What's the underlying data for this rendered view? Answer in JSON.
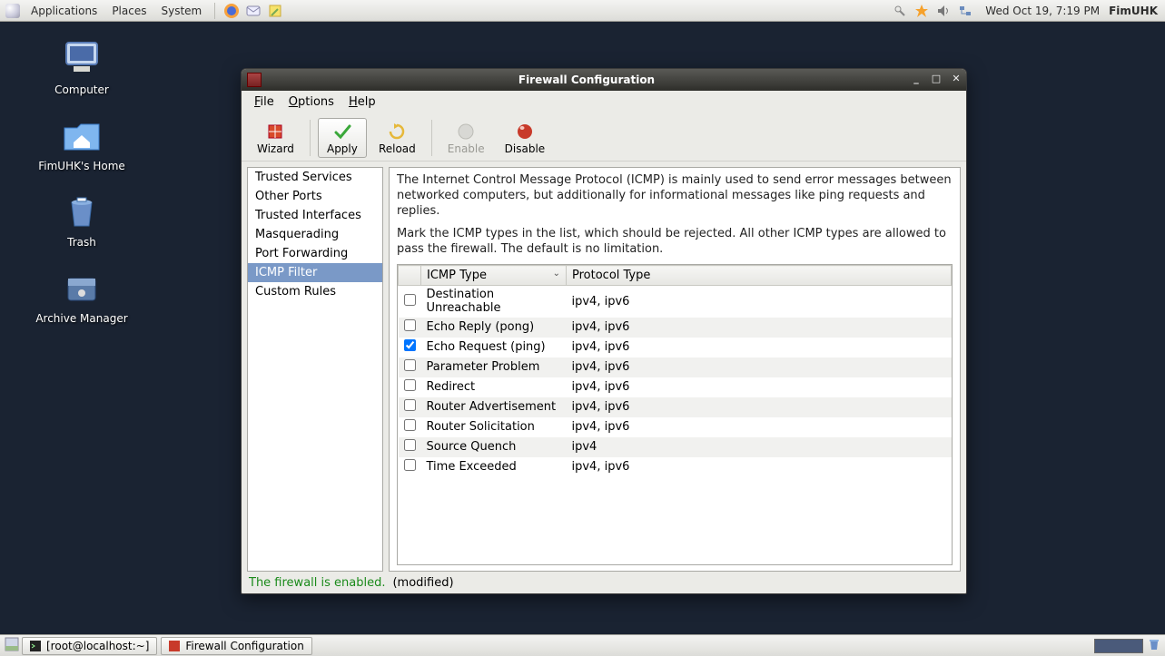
{
  "panel": {
    "menus": [
      "Applications",
      "Places",
      "System"
    ],
    "clock": "Wed Oct 19,  7:19 PM",
    "user": "FimUHK"
  },
  "desktop": {
    "computer": "Computer",
    "home": "FimUHK's Home",
    "trash": "Trash",
    "archive": "Archive Manager"
  },
  "window": {
    "title": "Firewall Configuration",
    "menus": {
      "file": "File",
      "options": "Options",
      "help": "Help"
    },
    "toolbar": {
      "wizard": "Wizard",
      "apply": "Apply",
      "reload": "Reload",
      "enable": "Enable",
      "disable": "Disable"
    },
    "sidebar": [
      "Trusted Services",
      "Other Ports",
      "Trusted Interfaces",
      "Masquerading",
      "Port Forwarding",
      "ICMP Filter",
      "Custom Rules"
    ],
    "sidebar_selected": 5,
    "desc1": "The Internet Control Message Protocol (ICMP) is mainly used to send error messages between networked computers, but additionally for informational messages like ping requests and replies.",
    "desc2": "Mark the ICMP types in the list, which should be rejected. All other ICMP types are allowed to pass the firewall. The default is no limitation.",
    "columns": {
      "icmp": "ICMP Type",
      "proto": "Protocol Type"
    },
    "rows": [
      {
        "checked": false,
        "name": "Destination Unreachable",
        "proto": "ipv4, ipv6"
      },
      {
        "checked": false,
        "name": "Echo Reply (pong)",
        "proto": "ipv4, ipv6"
      },
      {
        "checked": true,
        "name": "Echo Request (ping)",
        "proto": "ipv4, ipv6"
      },
      {
        "checked": false,
        "name": "Parameter Problem",
        "proto": "ipv4, ipv6"
      },
      {
        "checked": false,
        "name": "Redirect",
        "proto": "ipv4, ipv6"
      },
      {
        "checked": false,
        "name": "Router Advertisement",
        "proto": "ipv4, ipv6"
      },
      {
        "checked": false,
        "name": "Router Solicitation",
        "proto": "ipv4, ipv6"
      },
      {
        "checked": false,
        "name": "Source Quench",
        "proto": "ipv4"
      },
      {
        "checked": false,
        "name": "Time Exceeded",
        "proto": "ipv4, ipv6"
      }
    ],
    "status_enabled": "The firewall is enabled.",
    "status_modified": "(modified)"
  },
  "taskbar": {
    "terminal": "[root@localhost:~]",
    "firewall": "Firewall Configuration"
  }
}
